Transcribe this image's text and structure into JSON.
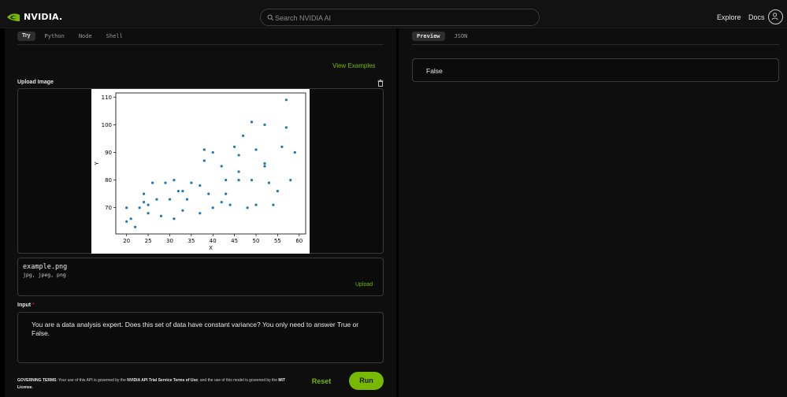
{
  "header": {
    "brand": "NVIDIA.",
    "search_placeholder": "Search NVIDIA AI",
    "nav_explore": "Explore",
    "nav_docs": "Docs"
  },
  "left": {
    "tabs": [
      {
        "label": "Try",
        "active": true
      },
      {
        "label": "Python",
        "active": false
      },
      {
        "label": "Node",
        "active": false
      },
      {
        "label": "Shell",
        "active": false
      }
    ],
    "view_examples": "View Examples",
    "upload_label": "Upload Image",
    "file": {
      "name": "example.png",
      "types": "jpg, jpeg, png",
      "upload": "Upload"
    },
    "input_label": "Input",
    "input_required": "*",
    "prompt": "You are a data analysis expert. Does this set of data have constant variance? You only need to answer True or False.",
    "governing": {
      "prefix": "GOVERNING TERMS",
      "text1": ": Your use of this API is governed by the ",
      "link1": "NVIDIA API Trial Service Terms of Use",
      "text2": "; and the use of this model is governed by the ",
      "link2": "MIT License",
      "text3": "."
    },
    "reset": "Reset",
    "run": "Run"
  },
  "right": {
    "tabs": [
      {
        "label": "Preview",
        "active": true
      },
      {
        "label": "JSON",
        "active": false
      }
    ],
    "result": "False"
  },
  "colors": {
    "accent": "#76b900",
    "point": "#1f77b4"
  },
  "chart_data": {
    "type": "scatter",
    "xlabel": "X",
    "ylabel": "Y",
    "xlim": [
      17.5,
      61.5
    ],
    "ylim": [
      60.5,
      111.5
    ],
    "xticks": [
      20,
      25,
      30,
      35,
      40,
      45,
      50,
      55,
      60
    ],
    "yticks": [
      70,
      80,
      90,
      100,
      110
    ],
    "grid": false,
    "points": [
      [
        20,
        65
      ],
      [
        20,
        70
      ],
      [
        21,
        66
      ],
      [
        22,
        63
      ],
      [
        23,
        70
      ],
      [
        24,
        72
      ],
      [
        24,
        75
      ],
      [
        25,
        68
      ],
      [
        25,
        71
      ],
      [
        26,
        79
      ],
      [
        27,
        73
      ],
      [
        28,
        67
      ],
      [
        29,
        79
      ],
      [
        30,
        73
      ],
      [
        31,
        66
      ],
      [
        31,
        80
      ],
      [
        32,
        76
      ],
      [
        33,
        69
      ],
      [
        33,
        76
      ],
      [
        34,
        73
      ],
      [
        35,
        79
      ],
      [
        37,
        68
      ],
      [
        37,
        78
      ],
      [
        38,
        87
      ],
      [
        38,
        91
      ],
      [
        39,
        75
      ],
      [
        40,
        70
      ],
      [
        40,
        90
      ],
      [
        42,
        72
      ],
      [
        42,
        85
      ],
      [
        43,
        75
      ],
      [
        43,
        80
      ],
      [
        44,
        71
      ],
      [
        45,
        92
      ],
      [
        46,
        80
      ],
      [
        46,
        83
      ],
      [
        46,
        89
      ],
      [
        47,
        96
      ],
      [
        48,
        70
      ],
      [
        49,
        101
      ],
      [
        49,
        80
      ],
      [
        50,
        91
      ],
      [
        50,
        71
      ],
      [
        52,
        85
      ],
      [
        52,
        86
      ],
      [
        52,
        100
      ],
      [
        53,
        79
      ],
      [
        54,
        71
      ],
      [
        55,
        76
      ],
      [
        56,
        92
      ],
      [
        57,
        109
      ],
      [
        57,
        99
      ],
      [
        58,
        80
      ],
      [
        59,
        90
      ]
    ]
  }
}
